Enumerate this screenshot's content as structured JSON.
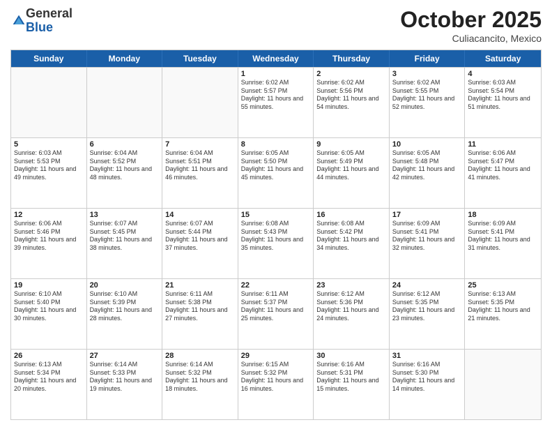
{
  "logo": {
    "general": "General",
    "blue": "Blue"
  },
  "header": {
    "month": "October 2025",
    "location": "Culiacancito, Mexico"
  },
  "weekdays": [
    "Sunday",
    "Monday",
    "Tuesday",
    "Wednesday",
    "Thursday",
    "Friday",
    "Saturday"
  ],
  "rows": [
    [
      {
        "day": "",
        "empty": true
      },
      {
        "day": "",
        "empty": true
      },
      {
        "day": "",
        "empty": true
      },
      {
        "day": "1",
        "sunrise": "6:02 AM",
        "sunset": "5:57 PM",
        "daylight": "11 hours and 55 minutes."
      },
      {
        "day": "2",
        "sunrise": "6:02 AM",
        "sunset": "5:56 PM",
        "daylight": "11 hours and 54 minutes."
      },
      {
        "day": "3",
        "sunrise": "6:02 AM",
        "sunset": "5:55 PM",
        "daylight": "11 hours and 52 minutes."
      },
      {
        "day": "4",
        "sunrise": "6:03 AM",
        "sunset": "5:54 PM",
        "daylight": "11 hours and 51 minutes."
      }
    ],
    [
      {
        "day": "5",
        "sunrise": "6:03 AM",
        "sunset": "5:53 PM",
        "daylight": "11 hours and 49 minutes."
      },
      {
        "day": "6",
        "sunrise": "6:04 AM",
        "sunset": "5:52 PM",
        "daylight": "11 hours and 48 minutes."
      },
      {
        "day": "7",
        "sunrise": "6:04 AM",
        "sunset": "5:51 PM",
        "daylight": "11 hours and 46 minutes."
      },
      {
        "day": "8",
        "sunrise": "6:05 AM",
        "sunset": "5:50 PM",
        "daylight": "11 hours and 45 minutes."
      },
      {
        "day": "9",
        "sunrise": "6:05 AM",
        "sunset": "5:49 PM",
        "daylight": "11 hours and 44 minutes."
      },
      {
        "day": "10",
        "sunrise": "6:05 AM",
        "sunset": "5:48 PM",
        "daylight": "11 hours and 42 minutes."
      },
      {
        "day": "11",
        "sunrise": "6:06 AM",
        "sunset": "5:47 PM",
        "daylight": "11 hours and 41 minutes."
      }
    ],
    [
      {
        "day": "12",
        "sunrise": "6:06 AM",
        "sunset": "5:46 PM",
        "daylight": "11 hours and 39 minutes."
      },
      {
        "day": "13",
        "sunrise": "6:07 AM",
        "sunset": "5:45 PM",
        "daylight": "11 hours and 38 minutes."
      },
      {
        "day": "14",
        "sunrise": "6:07 AM",
        "sunset": "5:44 PM",
        "daylight": "11 hours and 37 minutes."
      },
      {
        "day": "15",
        "sunrise": "6:08 AM",
        "sunset": "5:43 PM",
        "daylight": "11 hours and 35 minutes."
      },
      {
        "day": "16",
        "sunrise": "6:08 AM",
        "sunset": "5:42 PM",
        "daylight": "11 hours and 34 minutes."
      },
      {
        "day": "17",
        "sunrise": "6:09 AM",
        "sunset": "5:41 PM",
        "daylight": "11 hours and 32 minutes."
      },
      {
        "day": "18",
        "sunrise": "6:09 AM",
        "sunset": "5:41 PM",
        "daylight": "11 hours and 31 minutes."
      }
    ],
    [
      {
        "day": "19",
        "sunrise": "6:10 AM",
        "sunset": "5:40 PM",
        "daylight": "11 hours and 30 minutes."
      },
      {
        "day": "20",
        "sunrise": "6:10 AM",
        "sunset": "5:39 PM",
        "daylight": "11 hours and 28 minutes."
      },
      {
        "day": "21",
        "sunrise": "6:11 AM",
        "sunset": "5:38 PM",
        "daylight": "11 hours and 27 minutes."
      },
      {
        "day": "22",
        "sunrise": "6:11 AM",
        "sunset": "5:37 PM",
        "daylight": "11 hours and 25 minutes."
      },
      {
        "day": "23",
        "sunrise": "6:12 AM",
        "sunset": "5:36 PM",
        "daylight": "11 hours and 24 minutes."
      },
      {
        "day": "24",
        "sunrise": "6:12 AM",
        "sunset": "5:35 PM",
        "daylight": "11 hours and 23 minutes."
      },
      {
        "day": "25",
        "sunrise": "6:13 AM",
        "sunset": "5:35 PM",
        "daylight": "11 hours and 21 minutes."
      }
    ],
    [
      {
        "day": "26",
        "sunrise": "6:13 AM",
        "sunset": "5:34 PM",
        "daylight": "11 hours and 20 minutes."
      },
      {
        "day": "27",
        "sunrise": "6:14 AM",
        "sunset": "5:33 PM",
        "daylight": "11 hours and 19 minutes."
      },
      {
        "day": "28",
        "sunrise": "6:14 AM",
        "sunset": "5:32 PM",
        "daylight": "11 hours and 18 minutes."
      },
      {
        "day": "29",
        "sunrise": "6:15 AM",
        "sunset": "5:32 PM",
        "daylight": "11 hours and 16 minutes."
      },
      {
        "day": "30",
        "sunrise": "6:16 AM",
        "sunset": "5:31 PM",
        "daylight": "11 hours and 15 minutes."
      },
      {
        "day": "31",
        "sunrise": "6:16 AM",
        "sunset": "5:30 PM",
        "daylight": "11 hours and 14 minutes."
      },
      {
        "day": "",
        "empty": true
      }
    ]
  ],
  "labels": {
    "sunrise": "Sunrise:",
    "sunset": "Sunset:",
    "daylight": "Daylight:"
  }
}
